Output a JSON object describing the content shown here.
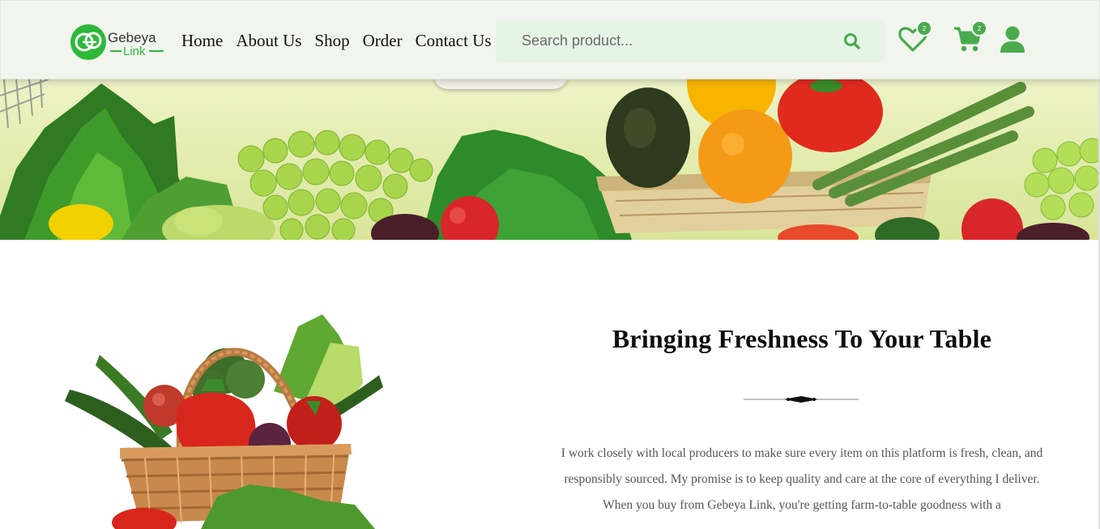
{
  "brand": {
    "name_top": "Gebeya",
    "name_bottom": "Link"
  },
  "nav": {
    "items": [
      {
        "label": "Home"
      },
      {
        "label": "About Us"
      },
      {
        "label": "Shop"
      },
      {
        "label": "Order"
      },
      {
        "label": "Contact Us"
      }
    ]
  },
  "search": {
    "placeholder": "Search product...",
    "value": "",
    "icon": "search-icon"
  },
  "actions": {
    "wishlist": {
      "icon": "heart-icon",
      "count": "2"
    },
    "cart": {
      "icon": "cart-icon",
      "count": "2"
    },
    "account": {
      "icon": "user-icon"
    }
  },
  "about": {
    "title": "Bringing Freshness To Your Table",
    "paragraph": "I work closely with local producers to make sure every item on this platform is fresh, clean, and responsibly sourced. My promise is to keep quality and care at the core of everything I deliver. When you buy from Gebeya Link, you're getting farm-to-table goodness with a"
  },
  "colors": {
    "accent": "#4aaa4e",
    "header_bg": "#f1f5ee",
    "search_bg": "#e6f4e6",
    "logo_green": "#2db83a"
  }
}
